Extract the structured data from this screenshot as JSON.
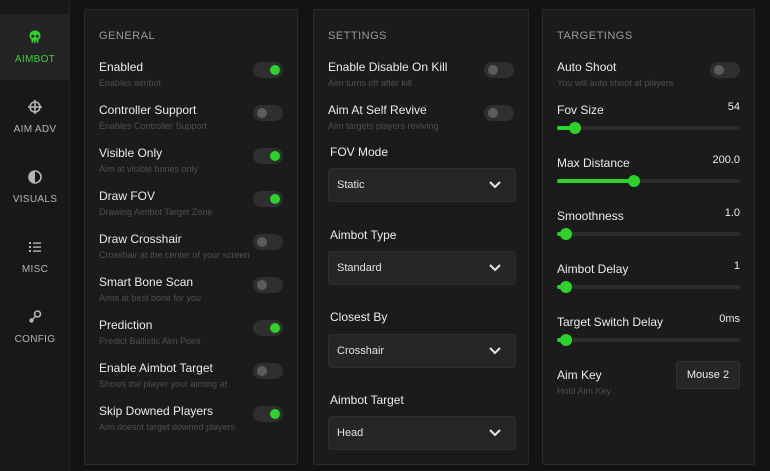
{
  "sidebar": {
    "items": [
      {
        "label": "AIMBOT",
        "icon": "skull-icon",
        "active": true
      },
      {
        "label": "AIM ADV",
        "icon": "crosshair-icon",
        "active": false
      },
      {
        "label": "VISUALS",
        "icon": "half-circle-icon",
        "active": false
      },
      {
        "label": "MISC",
        "icon": "list-icon",
        "active": false
      },
      {
        "label": "CONFIG",
        "icon": "nodes-icon",
        "active": false
      }
    ]
  },
  "general": {
    "title": "GENERAL",
    "items": [
      {
        "label": "Enabled",
        "desc": "Enables aimbot",
        "on": true
      },
      {
        "label": "Controller Support",
        "desc": "Enables Controller Support",
        "on": false
      },
      {
        "label": "Visible Only",
        "desc": "Aim at visible bones only",
        "on": true
      },
      {
        "label": "Draw FOV",
        "desc": "Drawing Aimbot Target Zone",
        "on": true
      },
      {
        "label": "Draw Crosshair",
        "desc": "Crosshair at the center of your screen",
        "on": false
      },
      {
        "label": "Smart Bone Scan",
        "desc": "Aims at best bone for you",
        "on": false
      },
      {
        "label": "Prediction",
        "desc": "Predict Ballistic Aim Point",
        "on": true
      },
      {
        "label": "Enable Aimbot Target",
        "desc": "Shows the player your aiming at",
        "on": false
      },
      {
        "label": "Skip Downed Players",
        "desc": "Aim doesnt target downed players",
        "on": true
      }
    ]
  },
  "settings": {
    "title": "SETTINGS",
    "toggles": [
      {
        "label": "Enable Disable On Kill",
        "desc": "Aim turns off after kill",
        "on": false
      },
      {
        "label": "Aim At Self Revive",
        "desc": "Aim targets players reviving",
        "on": false
      }
    ],
    "selects": [
      {
        "label": "FOV Mode",
        "value": "Static"
      },
      {
        "label": "Aimbot Type",
        "value": "Standard"
      },
      {
        "label": "Closest By",
        "value": "Crosshair"
      },
      {
        "label": "Aimbot Target",
        "value": "Head"
      }
    ]
  },
  "targetings": {
    "title": "TARGETINGS",
    "auto_shoot": {
      "label": "Auto Shoot",
      "desc": "You will auto shoot at players",
      "on": false
    },
    "sliders": [
      {
        "label": "Fov Size",
        "value": "54",
        "fraction": 0.09
      },
      {
        "label": "Max Distance",
        "value": "200.0",
        "fraction": 0.41
      },
      {
        "label": "Smoothness",
        "value": "1.0",
        "fraction": 0.04
      },
      {
        "label": "Aimbot Delay",
        "value": "1",
        "fraction": 0.04
      },
      {
        "label": "Target Switch Delay",
        "value": "0ms",
        "fraction": 0.04
      }
    ],
    "aim_key": {
      "label": "Aim Key",
      "desc": "Hold Aim Key",
      "value": "Mouse 2"
    }
  },
  "colors": {
    "accent": "#2bd32b",
    "background": "#131313",
    "panel": "#1b1b1b"
  }
}
